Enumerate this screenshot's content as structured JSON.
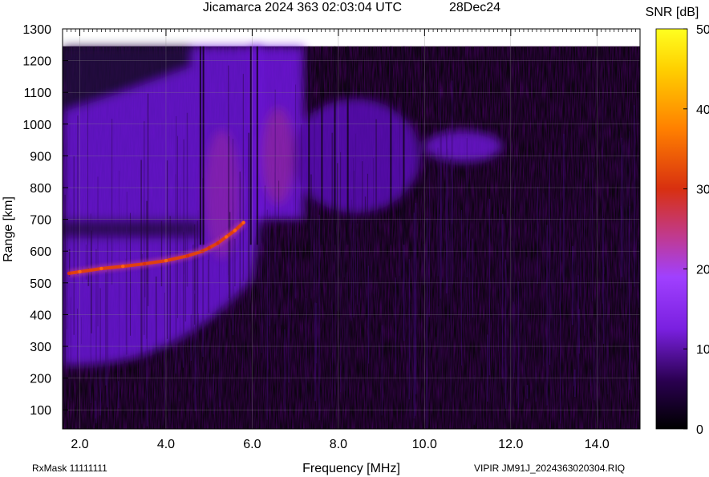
{
  "chart_data": {
    "type": "heatmap",
    "title": "Jicamarca 2024 363 02:03:04 UTC",
    "date": "28Dec24",
    "xlabel": "Frequency [MHz]",
    "ylabel": "Range [km]",
    "colorbar_label": "SNR [dB]",
    "xlim": [
      1.6,
      15.0
    ],
    "ylim": [
      40,
      1300
    ],
    "data_top_km": 1245,
    "zlim": [
      0,
      50
    ],
    "x_ticks": [
      "2.0",
      "4.0",
      "6.0",
      "8.0",
      "10.0",
      "12.0",
      "14.0"
    ],
    "x_tick_values": [
      2,
      4,
      6,
      8,
      10,
      12,
      14
    ],
    "y_ticks": [
      "100",
      "200",
      "300",
      "400",
      "500",
      "600",
      "700",
      "800",
      "900",
      "1000",
      "1100",
      "1200",
      "1300"
    ],
    "y_tick_values": [
      100,
      200,
      300,
      400,
      500,
      600,
      700,
      800,
      900,
      1000,
      1100,
      1200,
      1300
    ],
    "z_ticks": [
      "0",
      "10",
      "20",
      "30",
      "40",
      "50"
    ],
    "z_tick_values": [
      0,
      10,
      20,
      30,
      40,
      50
    ],
    "colormap": [
      "#000000",
      "#2a0050",
      "#6a10c8",
      "#9a30ff",
      "#c03080",
      "#e04010",
      "#ff9000",
      "#ffe000",
      "#ffff40"
    ],
    "grid": true,
    "echo_trace": {
      "name": "",
      "freq_mhz": [
        1.75,
        2.0,
        2.5,
        3.0,
        3.5,
        4.0,
        4.5,
        4.85,
        5.0,
        5.2,
        5.4,
        5.6,
        5.8
      ],
      "range_km": [
        530,
        535,
        545,
        552,
        560,
        570,
        585,
        600,
        610,
        625,
        645,
        665,
        690
      ],
      "snr_db": [
        24,
        26,
        25,
        25,
        24,
        25,
        24,
        22,
        20,
        22,
        25,
        27,
        26
      ]
    },
    "regions": [
      {
        "desc": "upper band",
        "f0": 1.6,
        "f1": 6.2,
        "snr_db": 12
      },
      {
        "desc": "F trace cloud",
        "f0": 6.0,
        "f1": 9.8,
        "r0": 700,
        "r1": 1245,
        "snr_db": 14
      },
      {
        "desc": "high range echo",
        "f0": 9.8,
        "f1": 11.8,
        "r0": 880,
        "r1": 990,
        "snr_db": 12
      }
    ]
  },
  "footer": {
    "left": "RxMask 11111111",
    "right": "VIPIR  JM91J_2024363020304.RIQ"
  }
}
